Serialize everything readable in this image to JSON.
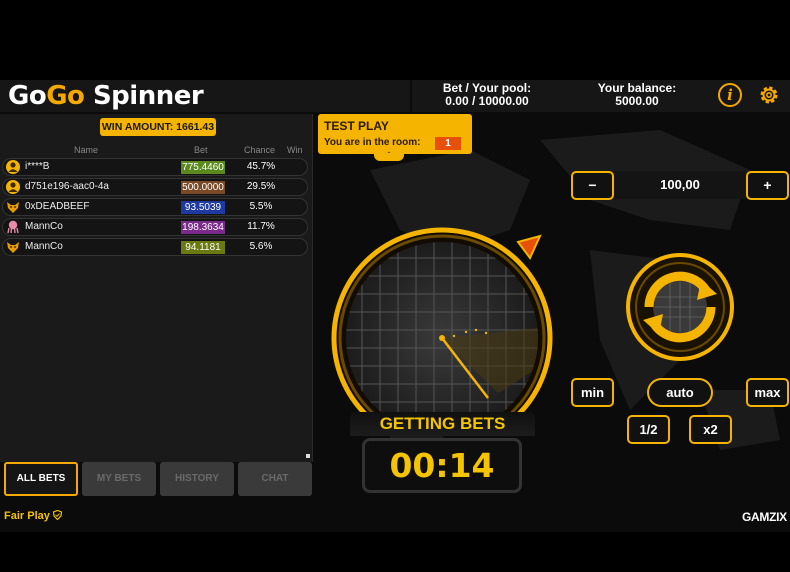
{
  "header": {
    "logo": {
      "part1": "Go",
      "part2": "Go",
      "part3": " Spinner"
    },
    "bet_pool_label": "Bet / Your pool:",
    "bet_pool_value": "0.00 / 10000.00",
    "balance_label": "Your balance:",
    "balance_value": "5000.00",
    "info_icon_glyph": "i",
    "settings_icon": "gear-icon"
  },
  "bets_panel": {
    "win_amount": "WIN AMOUNT: 1661.43",
    "columns": {
      "name": "Name",
      "bet": "Bet",
      "chance": "Chance",
      "win": "Win"
    },
    "rows": [
      {
        "name": "i****B",
        "bet": "775.4460",
        "chance": "45.7%",
        "color": "#5a8a1e",
        "avatar": "user-avatar"
      },
      {
        "name": "d751e196-aac0-4a",
        "bet": "500.0000",
        "chance": "29.5%",
        "color": "#7a4a26",
        "avatar": "user-avatar"
      },
      {
        "name": "0xDEADBEEF",
        "bet": "93.5039",
        "chance": "5.5%",
        "color": "#1e3aa0",
        "avatar": "fox-avatar"
      },
      {
        "name": "MannCo",
        "bet": "198.3634",
        "chance": "11.7%",
        "color": "#7a2a8a",
        "avatar": "octopus-avatar"
      },
      {
        "name": "MannCo",
        "bet": "94.1181",
        "chance": "5.6%",
        "color": "#6a7a10",
        "avatar": "fox-avatar"
      }
    ]
  },
  "tabs": [
    {
      "label": "ALL BETS",
      "active": true
    },
    {
      "label": "MY BETS",
      "active": false
    },
    {
      "label": "HISTORY",
      "active": false
    },
    {
      "label": "CHAT",
      "active": false
    }
  ],
  "test_play": {
    "title": "TEST PLAY",
    "room_label": "You are in the room:",
    "room_count": "1",
    "chevron": "ˇ"
  },
  "game": {
    "status": "GETTING BETS",
    "timer": "00:14"
  },
  "controls": {
    "minus": "−",
    "amount": "100,00",
    "plus": "+",
    "min": "min",
    "auto": "auto",
    "max": "max",
    "half": "1/2",
    "double": "x2"
  },
  "footer": {
    "fair_play": "Fair Play",
    "brand": "GAMZIX"
  },
  "colors": {
    "accent": "#f5b400",
    "orange": "#e8500a",
    "background": "#0b0b0b"
  }
}
